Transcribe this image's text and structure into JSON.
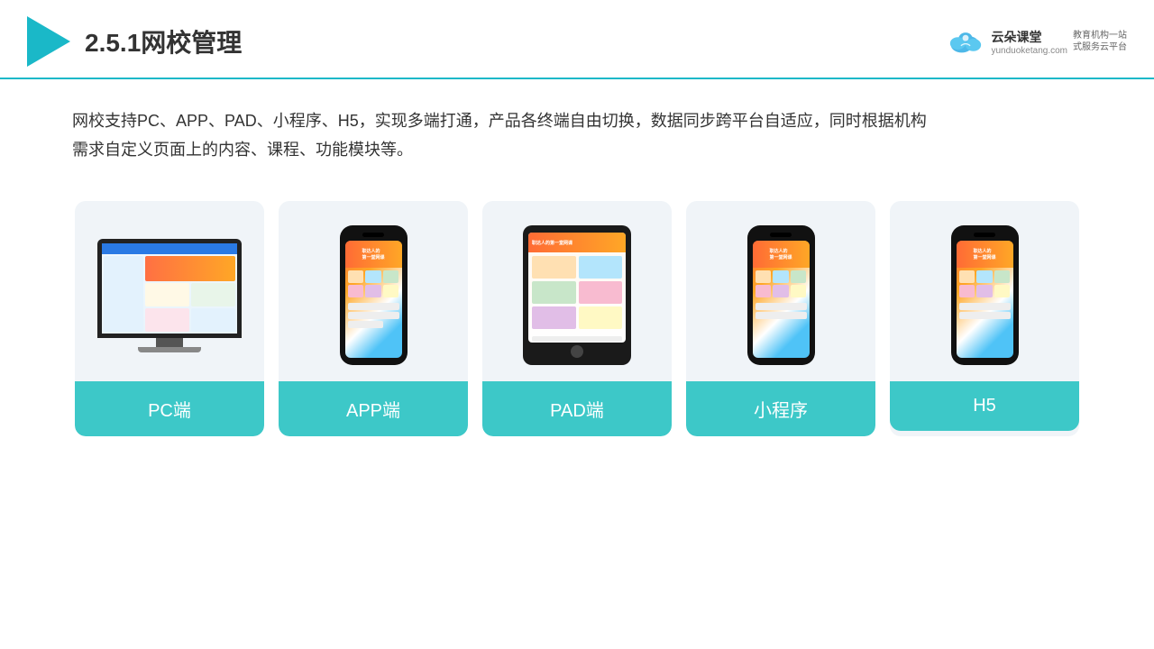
{
  "header": {
    "title": "2.5.1网校管理",
    "brand": {
      "name": "云朵课堂",
      "tagline": "教育机构一站\n式服务云平台",
      "url": "yunduoketang.com"
    }
  },
  "description": {
    "text": "网校支持PC、APP、PAD、小程序、H5，实现多端打通，产品各终端自由切换，数据同步跨平台自适应，同时根据机构需求自定义页面上的内容、课程、功能模块等。"
  },
  "cards": [
    {
      "id": "pc",
      "label": "PC端",
      "type": "pc"
    },
    {
      "id": "app",
      "label": "APP端",
      "type": "phone"
    },
    {
      "id": "pad",
      "label": "PAD端",
      "type": "tablet"
    },
    {
      "id": "miniprogram",
      "label": "小程序",
      "type": "phone2"
    },
    {
      "id": "h5",
      "label": "H5",
      "type": "phone3"
    }
  ],
  "colors": {
    "teal": "#3dc8c8",
    "header_line": "#1ab8c8"
  }
}
